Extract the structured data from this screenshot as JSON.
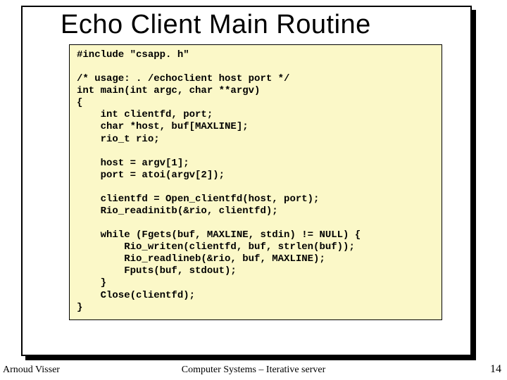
{
  "title": "Echo Client Main Routine",
  "code": "#include \"csapp. h\"\n\n/* usage: . /echoclient host port */\nint main(int argc, char **argv)\n{\n    int clientfd, port;\n    char *host, buf[MAXLINE];\n    rio_t rio;\n\n    host = argv[1];\n    port = atoi(argv[2]);\n\n    clientfd = Open_clientfd(host, port);\n    Rio_readinitb(&rio, clientfd);\n\n    while (Fgets(buf, MAXLINE, stdin) != NULL) {\n        Rio_writen(clientfd, buf, strlen(buf));\n        Rio_readlineb(&rio, buf, MAXLINE);\n        Fputs(buf, stdout);\n    }\n    Close(clientfd);\n}",
  "author": "Arnoud Visser",
  "footer": "Computer Systems – Iterative server",
  "page": "14"
}
